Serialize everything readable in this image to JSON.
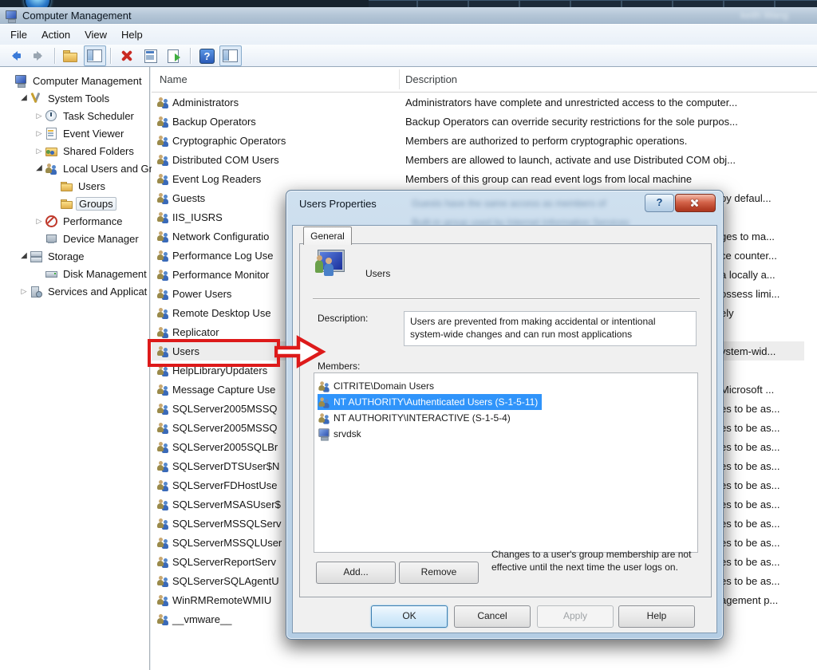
{
  "window": {
    "title": "Computer Management",
    "user_badge": "keith Wang"
  },
  "menu": {
    "items": [
      {
        "label": "File"
      },
      {
        "label": "Action"
      },
      {
        "label": "View"
      },
      {
        "label": "Help"
      }
    ]
  },
  "toolbar": {
    "items": [
      {
        "type": "back",
        "name": "back-icon"
      },
      {
        "type": "fwd",
        "name": "forward-icon"
      },
      {
        "type": "sep",
        "name": "separator"
      },
      {
        "type": "folderup",
        "name": "up-folder-icon"
      },
      {
        "type": "win",
        "name": "console-tree-icon",
        "checked": true
      },
      {
        "type": "sep",
        "name": "separator"
      },
      {
        "type": "delete",
        "name": "delete-icon"
      },
      {
        "type": "props",
        "name": "properties-icon"
      },
      {
        "type": "export",
        "name": "export-list-icon"
      },
      {
        "type": "sep",
        "name": "separator"
      },
      {
        "type": "help",
        "name": "help-icon"
      },
      {
        "type": "win",
        "name": "action-pane-icon",
        "checked": true
      }
    ]
  },
  "tree": {
    "items": [
      {
        "label": "Computer Management",
        "depth": 0,
        "icon": "computer"
      },
      {
        "label": "System Tools",
        "depth": 1,
        "expander": "expanded",
        "icon": "tools"
      },
      {
        "label": "Task Scheduler",
        "depth": 2,
        "expander": "collapsed",
        "icon": "clock"
      },
      {
        "label": "Event Viewer",
        "depth": 2,
        "expander": "collapsed",
        "icon": "eventlog"
      },
      {
        "label": "Shared Folders",
        "depth": 2,
        "expander": "collapsed",
        "icon": "sharedfolder"
      },
      {
        "label": "Local Users and Gr",
        "depth": 2,
        "expander": "expanded",
        "icon": "group"
      },
      {
        "label": "Users",
        "depth": 3,
        "icon": "folder"
      },
      {
        "label": "Groups",
        "depth": 3,
        "icon": "folder",
        "selected": true
      },
      {
        "label": "Performance",
        "depth": 2,
        "expander": "collapsed",
        "icon": "perf"
      },
      {
        "label": "Device Manager",
        "depth": 2,
        "icon": "device"
      },
      {
        "label": "Storage",
        "depth": 1,
        "expander": "expanded",
        "icon": "storage"
      },
      {
        "label": "Disk Management",
        "depth": 2,
        "icon": "disk"
      },
      {
        "label": "Services and Applicat",
        "depth": 1,
        "expander": "collapsed",
        "icon": "services"
      }
    ]
  },
  "grouplist": {
    "columns": [
      "Name",
      "Description"
    ],
    "rows": [
      {
        "name": "Administrators",
        "icon": "group",
        "desc": "Administrators have complete and unrestricted access to the computer..."
      },
      {
        "name": "Backup Operators",
        "icon": "group",
        "desc": "Backup Operators can override security restrictions for the sole purpos..."
      },
      {
        "name": "Cryptographic Operators",
        "icon": "group",
        "desc": "Members are authorized to perform cryptographic operations."
      },
      {
        "name": "Distributed COM Users",
        "icon": "group",
        "desc": "Members are allowed to launch, activate and use Distributed COM obj..."
      },
      {
        "name": "Event Log Readers",
        "icon": "group",
        "desc": "Members of this group can read event logs from local machine"
      },
      {
        "name": "Guests",
        "icon": "group",
        "frag": "by defaul..."
      },
      {
        "name": "IIS_IUSRS",
        "icon": "group"
      },
      {
        "name": "Network Configuratio",
        "icon": "group",
        "frag": "ges to ma..."
      },
      {
        "name": "Performance Log Use",
        "icon": "group",
        "frag": "ce counter..."
      },
      {
        "name": "Performance Monitor",
        "icon": "group",
        "frag": "a locally a..."
      },
      {
        "name": "Power Users",
        "icon": "group",
        "frag": "ossess limi..."
      },
      {
        "name": "Remote Desktop Use",
        "icon": "group",
        "frag": "ely"
      },
      {
        "name": "Replicator",
        "icon": "group"
      },
      {
        "name": "Users",
        "icon": "group",
        "frag": "ystem-wid...",
        "selected": true
      },
      {
        "name": "HelpLibraryUpdaters",
        "icon": "group"
      },
      {
        "name": "Message Capture Use",
        "icon": "group",
        "frag": "Microsoft ..."
      },
      {
        "name": "SQLServer2005MSSQ",
        "icon": "group",
        "frag": "es to be as..."
      },
      {
        "name": "SQLServer2005MSSQ",
        "icon": "group",
        "frag": "es to be as..."
      },
      {
        "name": "SQLServer2005SQLBr",
        "icon": "group",
        "frag": "es to be as..."
      },
      {
        "name": "SQLServerDTSUser$N",
        "icon": "group",
        "frag": "es to be as..."
      },
      {
        "name": "SQLServerFDHostUse",
        "icon": "group",
        "frag": "es to be as..."
      },
      {
        "name": "SQLServerMSASUser$",
        "icon": "group",
        "frag": "es to be as..."
      },
      {
        "name": "SQLServerMSSQLServ",
        "icon": "group",
        "frag": "es to be as..."
      },
      {
        "name": "SQLServerMSSQLUser",
        "icon": "group",
        "frag": "es to be as..."
      },
      {
        "name": "SQLServerReportServ",
        "icon": "group",
        "frag": "es to be as..."
      },
      {
        "name": "SQLServerSQLAgentU",
        "icon": "group",
        "frag": "es to be as..."
      },
      {
        "name": "WinRMRemoteWMIU",
        "icon": "group",
        "frag": "agement p..."
      },
      {
        "name": "__vmware__",
        "icon": "group"
      }
    ]
  },
  "dialog": {
    "title": "Users Properties",
    "ghost": [
      "Guests have the same access as members of",
      "Built-in group used by Internet Information Services"
    ],
    "tab": "General",
    "group_name": "Users",
    "description_label": "Description:",
    "description_value": "Users are prevented from making accidental or intentional system-wide changes and can run most applications",
    "members_label": "Members:",
    "members": [
      {
        "name": "CITRITE\\Domain Users",
        "icon": "group"
      },
      {
        "name": "NT AUTHORITY\\Authenticated Users (S-1-5-11)",
        "icon": "group",
        "selected": true
      },
      {
        "name": "NT AUTHORITY\\INTERACTIVE (S-1-5-4)",
        "icon": "group"
      },
      {
        "name": "srvdsk",
        "icon": "computer"
      }
    ],
    "note": "Changes to a user's group membership are not effective until the next time the user logs on.",
    "buttons": {
      "add": "Add...",
      "remove": "Remove",
      "ok": "OK",
      "cancel": "Cancel",
      "apply": "Apply",
      "help": "Help"
    }
  },
  "annotation_color": "#dd1a1a"
}
